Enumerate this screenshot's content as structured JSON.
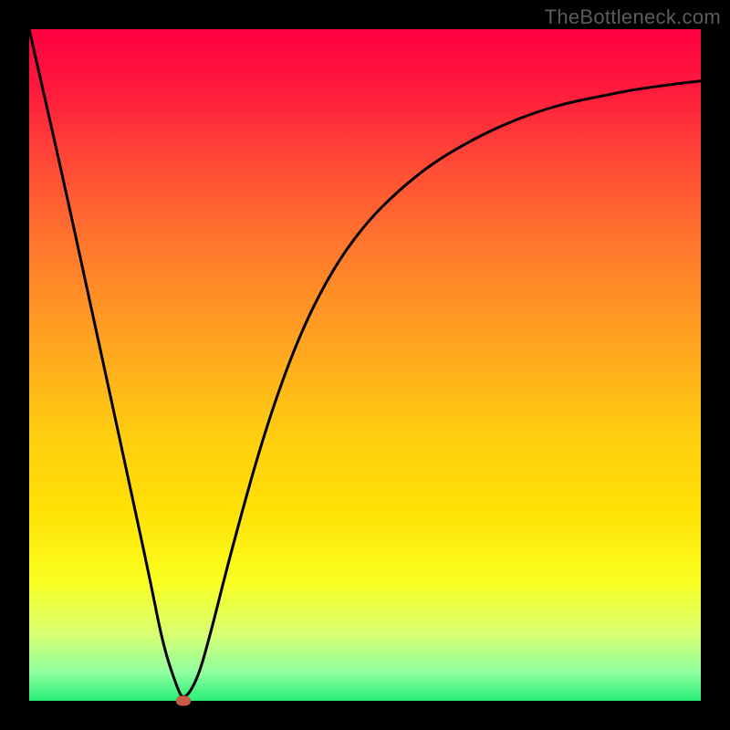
{
  "watermark": "TheBottleneck.com",
  "chart_data": {
    "type": "line",
    "title": "",
    "xlabel": "",
    "ylabel": "",
    "xlim": [
      0,
      100
    ],
    "ylim": [
      0,
      100
    ],
    "series": [
      {
        "name": "bottleneck-curve",
        "x": [
          0,
          5,
          10,
          15,
          18,
          20,
          22,
          23,
          25,
          27,
          30,
          35,
          40,
          45,
          50,
          55,
          60,
          65,
          70,
          75,
          80,
          85,
          90,
          95,
          100
        ],
        "values": [
          100,
          78,
          55,
          32,
          18,
          8,
          2,
          0,
          3,
          10,
          22,
          40,
          54,
          64,
          71,
          76,
          80,
          83,
          85.5,
          87.5,
          89,
          90,
          91,
          91.7,
          92.3
        ]
      }
    ],
    "marker": {
      "x": 23,
      "y": 0
    },
    "gradient_stops": [
      {
        "pct": 0,
        "color": "#ff0040"
      },
      {
        "pct": 50,
        "color": "#ffc000"
      },
      {
        "pct": 80,
        "color": "#f5ff30"
      },
      {
        "pct": 100,
        "color": "#27ef76"
      }
    ]
  }
}
